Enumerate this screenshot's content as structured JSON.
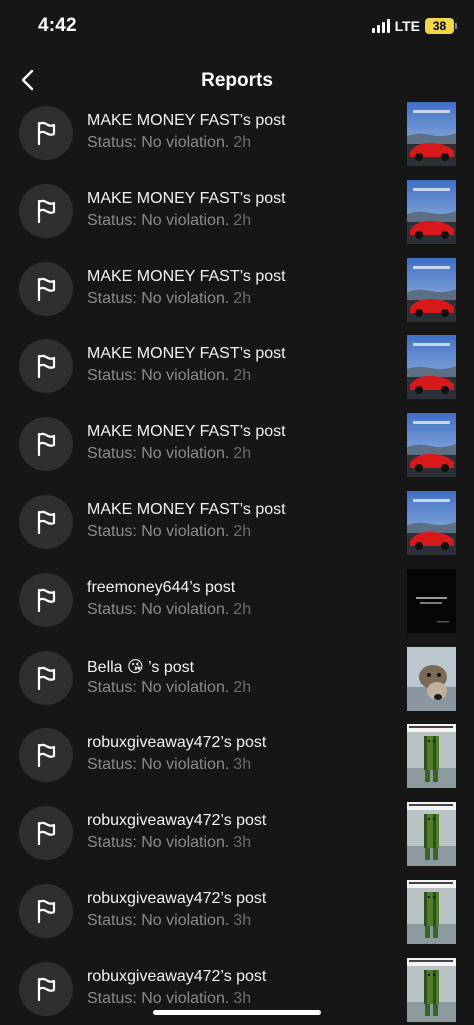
{
  "status_bar": {
    "time": "4:42",
    "network": "LTE",
    "battery": "38"
  },
  "nav": {
    "title": "Reports",
    "back_icon": "chevron-left-icon"
  },
  "colors": {
    "background": "#161616",
    "avatar": "#2f2f2f",
    "status_text": "#8b8b8b",
    "battery": "#f2d649"
  },
  "reports": [
    {
      "title": "MAKE MONEY FAST’s post",
      "status": "Status: No violation.",
      "time": "2h",
      "thumb": "car"
    },
    {
      "title": "MAKE MONEY FAST’s post",
      "status": "Status: No violation.",
      "time": "2h",
      "thumb": "car"
    },
    {
      "title": "MAKE MONEY FAST’s post",
      "status": "Status: No violation.",
      "time": "2h",
      "thumb": "car"
    },
    {
      "title": "MAKE MONEY FAST’s post",
      "status": "Status: No violation.",
      "time": "2h",
      "thumb": "car"
    },
    {
      "title": "MAKE MONEY FAST’s post",
      "status": "Status: No violation.",
      "time": "2h",
      "thumb": "car"
    },
    {
      "title": "MAKE MONEY FAST’s post",
      "status": "Status: No violation.",
      "time": "2h",
      "thumb": "car"
    },
    {
      "title": "freemoney644’s post",
      "status": "Status: No violation.",
      "time": "2h",
      "thumb": "dark"
    },
    {
      "title": "Bella 😘 ’s post",
      "status": "Status: No violation.",
      "time": "2h",
      "thumb": "dog"
    },
    {
      "title": "robuxgiveaway472’s post",
      "status": "Status: No violation.",
      "time": "3h",
      "thumb": "robux"
    },
    {
      "title": "robuxgiveaway472’s post",
      "status": "Status: No violation.",
      "time": "3h",
      "thumb": "robux"
    },
    {
      "title": "robuxgiveaway472’s post",
      "status": "Status: No violation.",
      "time": "3h",
      "thumb": "robux"
    },
    {
      "title": "robuxgiveaway472’s post",
      "status": "Status: No violation.",
      "time": "3h",
      "thumb": "robux"
    }
  ]
}
